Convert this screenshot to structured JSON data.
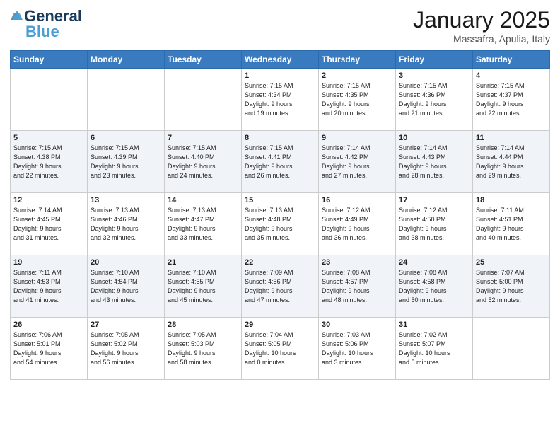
{
  "header": {
    "logo_general": "General",
    "logo_blue": "Blue",
    "month": "January 2025",
    "location": "Massafra, Apulia, Italy"
  },
  "days_of_week": [
    "Sunday",
    "Monday",
    "Tuesday",
    "Wednesday",
    "Thursday",
    "Friday",
    "Saturday"
  ],
  "weeks": [
    [
      {
        "day": "",
        "info": ""
      },
      {
        "day": "",
        "info": ""
      },
      {
        "day": "",
        "info": ""
      },
      {
        "day": "1",
        "info": "Sunrise: 7:15 AM\nSunset: 4:34 PM\nDaylight: 9 hours\nand 19 minutes."
      },
      {
        "day": "2",
        "info": "Sunrise: 7:15 AM\nSunset: 4:35 PM\nDaylight: 9 hours\nand 20 minutes."
      },
      {
        "day": "3",
        "info": "Sunrise: 7:15 AM\nSunset: 4:36 PM\nDaylight: 9 hours\nand 21 minutes."
      },
      {
        "day": "4",
        "info": "Sunrise: 7:15 AM\nSunset: 4:37 PM\nDaylight: 9 hours\nand 22 minutes."
      }
    ],
    [
      {
        "day": "5",
        "info": "Sunrise: 7:15 AM\nSunset: 4:38 PM\nDaylight: 9 hours\nand 22 minutes."
      },
      {
        "day": "6",
        "info": "Sunrise: 7:15 AM\nSunset: 4:39 PM\nDaylight: 9 hours\nand 23 minutes."
      },
      {
        "day": "7",
        "info": "Sunrise: 7:15 AM\nSunset: 4:40 PM\nDaylight: 9 hours\nand 24 minutes."
      },
      {
        "day": "8",
        "info": "Sunrise: 7:15 AM\nSunset: 4:41 PM\nDaylight: 9 hours\nand 26 minutes."
      },
      {
        "day": "9",
        "info": "Sunrise: 7:14 AM\nSunset: 4:42 PM\nDaylight: 9 hours\nand 27 minutes."
      },
      {
        "day": "10",
        "info": "Sunrise: 7:14 AM\nSunset: 4:43 PM\nDaylight: 9 hours\nand 28 minutes."
      },
      {
        "day": "11",
        "info": "Sunrise: 7:14 AM\nSunset: 4:44 PM\nDaylight: 9 hours\nand 29 minutes."
      }
    ],
    [
      {
        "day": "12",
        "info": "Sunrise: 7:14 AM\nSunset: 4:45 PM\nDaylight: 9 hours\nand 31 minutes."
      },
      {
        "day": "13",
        "info": "Sunrise: 7:13 AM\nSunset: 4:46 PM\nDaylight: 9 hours\nand 32 minutes."
      },
      {
        "day": "14",
        "info": "Sunrise: 7:13 AM\nSunset: 4:47 PM\nDaylight: 9 hours\nand 33 minutes."
      },
      {
        "day": "15",
        "info": "Sunrise: 7:13 AM\nSunset: 4:48 PM\nDaylight: 9 hours\nand 35 minutes."
      },
      {
        "day": "16",
        "info": "Sunrise: 7:12 AM\nSunset: 4:49 PM\nDaylight: 9 hours\nand 36 minutes."
      },
      {
        "day": "17",
        "info": "Sunrise: 7:12 AM\nSunset: 4:50 PM\nDaylight: 9 hours\nand 38 minutes."
      },
      {
        "day": "18",
        "info": "Sunrise: 7:11 AM\nSunset: 4:51 PM\nDaylight: 9 hours\nand 40 minutes."
      }
    ],
    [
      {
        "day": "19",
        "info": "Sunrise: 7:11 AM\nSunset: 4:53 PM\nDaylight: 9 hours\nand 41 minutes."
      },
      {
        "day": "20",
        "info": "Sunrise: 7:10 AM\nSunset: 4:54 PM\nDaylight: 9 hours\nand 43 minutes."
      },
      {
        "day": "21",
        "info": "Sunrise: 7:10 AM\nSunset: 4:55 PM\nDaylight: 9 hours\nand 45 minutes."
      },
      {
        "day": "22",
        "info": "Sunrise: 7:09 AM\nSunset: 4:56 PM\nDaylight: 9 hours\nand 47 minutes."
      },
      {
        "day": "23",
        "info": "Sunrise: 7:08 AM\nSunset: 4:57 PM\nDaylight: 9 hours\nand 48 minutes."
      },
      {
        "day": "24",
        "info": "Sunrise: 7:08 AM\nSunset: 4:58 PM\nDaylight: 9 hours\nand 50 minutes."
      },
      {
        "day": "25",
        "info": "Sunrise: 7:07 AM\nSunset: 5:00 PM\nDaylight: 9 hours\nand 52 minutes."
      }
    ],
    [
      {
        "day": "26",
        "info": "Sunrise: 7:06 AM\nSunset: 5:01 PM\nDaylight: 9 hours\nand 54 minutes."
      },
      {
        "day": "27",
        "info": "Sunrise: 7:05 AM\nSunset: 5:02 PM\nDaylight: 9 hours\nand 56 minutes."
      },
      {
        "day": "28",
        "info": "Sunrise: 7:05 AM\nSunset: 5:03 PM\nDaylight: 9 hours\nand 58 minutes."
      },
      {
        "day": "29",
        "info": "Sunrise: 7:04 AM\nSunset: 5:05 PM\nDaylight: 10 hours\nand 0 minutes."
      },
      {
        "day": "30",
        "info": "Sunrise: 7:03 AM\nSunset: 5:06 PM\nDaylight: 10 hours\nand 3 minutes."
      },
      {
        "day": "31",
        "info": "Sunrise: 7:02 AM\nSunset: 5:07 PM\nDaylight: 10 hours\nand 5 minutes."
      },
      {
        "day": "",
        "info": ""
      }
    ]
  ]
}
